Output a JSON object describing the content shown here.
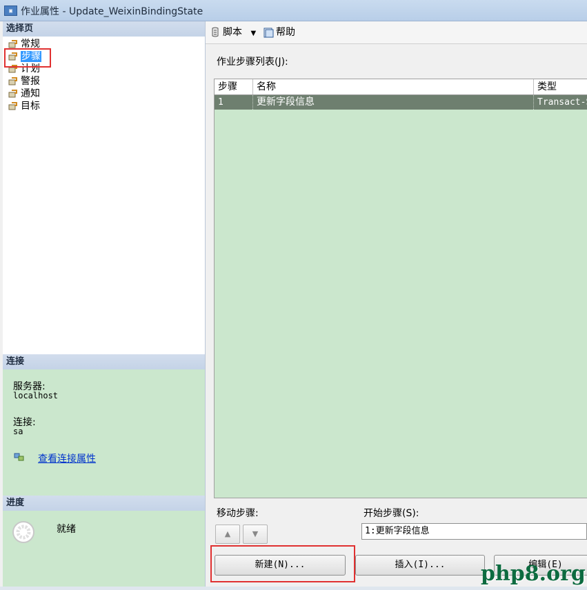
{
  "window": {
    "title": "作业属性 - Update_WeixinBindingState",
    "icon": "dialog-icon"
  },
  "left_pane": {
    "select_page_header": "选择页",
    "nav_items": [
      {
        "label": "常规",
        "icon": "wrench-icon",
        "selected": false
      },
      {
        "label": "步骤",
        "icon": "wrench-icon",
        "selected": true
      },
      {
        "label": "计划",
        "icon": "wrench-icon",
        "selected": false
      },
      {
        "label": "警报",
        "icon": "wrench-icon",
        "selected": false
      },
      {
        "label": "通知",
        "icon": "wrench-icon",
        "selected": false
      },
      {
        "label": "目标",
        "icon": "wrench-icon",
        "selected": false
      }
    ],
    "connection": {
      "header": "连接",
      "server_label": "服务器:",
      "server_value": "localhost",
      "connection_label": "连接:",
      "connection_value": "sa",
      "view_props_link": "查看连接属性"
    },
    "progress": {
      "header": "进度",
      "status": "就绪"
    }
  },
  "toolbar": {
    "script_label": "脚本",
    "help_label": "帮助"
  },
  "main": {
    "step_list_label": "作业步骤列表(J):",
    "columns": [
      "步骤",
      "名称",
      "类型"
    ],
    "rows": [
      {
        "step": "1",
        "name": "更新字段信息",
        "type": "Transact-SQL"
      }
    ],
    "move_step_label": "移动步骤:",
    "start_step_label": "开始步骤(S):",
    "start_step_value": "1:更新字段信息",
    "buttons": {
      "new": "新建(N)...",
      "insert": "插入(I)...",
      "edit": "编辑(E)"
    }
  },
  "watermark": "php8.org",
  "colors": {
    "selection": "#3399ff",
    "panel_green": "#cbe7cd",
    "highlight_red": "#e03030",
    "link": "#0033cc"
  }
}
